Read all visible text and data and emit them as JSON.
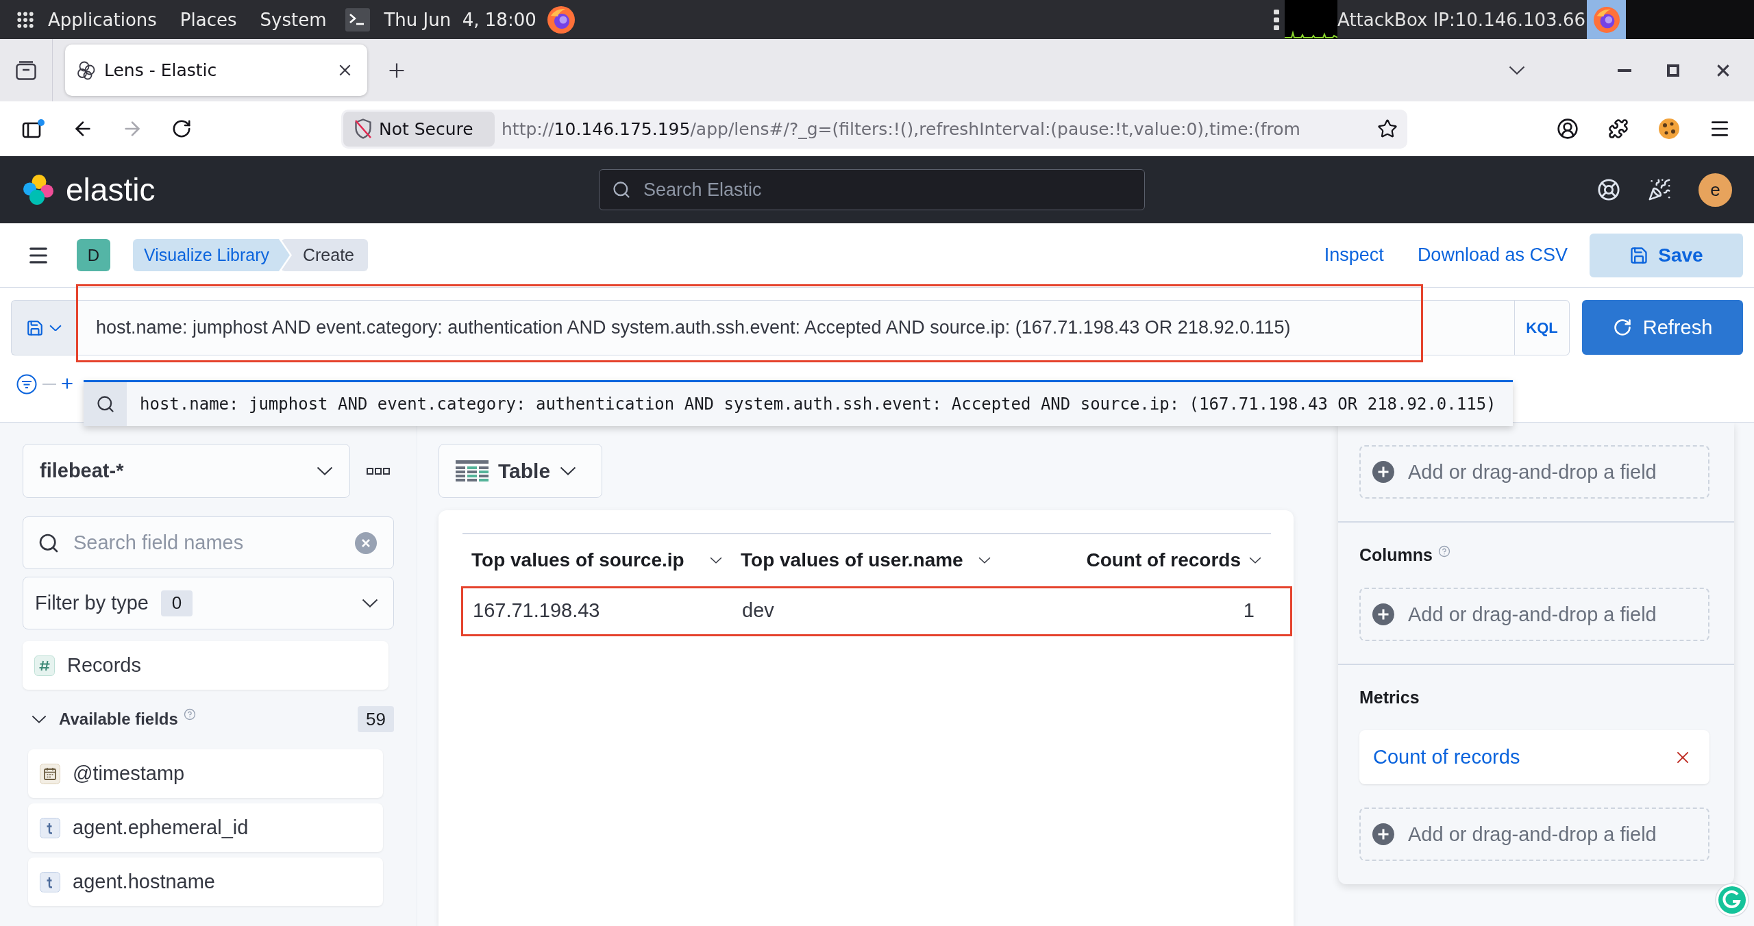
{
  "desktop_bar": {
    "menus": [
      "Applications",
      "Places",
      "System"
    ],
    "clock": "Thu Jun  4, 18:00",
    "status_text": "AttackBox IP:10.146.103.66"
  },
  "browser": {
    "tabs": [
      {
        "title": "Lens - Elastic",
        "selected": true
      }
    ],
    "security_label": "Not Secure",
    "url": {
      "scheme": "http://",
      "host": "10.146.175.195",
      "path": "/app/lens#/?_g=(filters:!(),refreshInterval:(pause:!t,value:0),time:(from"
    }
  },
  "kibana_header": {
    "brand": "elastic",
    "search": {
      "placeholder": "Search Elastic"
    },
    "avatar": "e"
  },
  "app_bar": {
    "space_badge": "D",
    "breadcrumbs": [
      {
        "label": "Visualize Library",
        "current": false
      },
      {
        "label": "Create",
        "current": true
      }
    ],
    "links": [
      "Inspect",
      "Download as CSV"
    ],
    "save_button": "Save"
  },
  "query_bar": {
    "query": "host.name: jumphost AND event.category: authentication AND system.auth.ssh.event: Accepted AND source.ip: (167.71.198.43 OR 218.92.0.115)",
    "highlighted": true,
    "language": "KQL",
    "refresh_button": "Refresh"
  },
  "suggestions": [
    "host.name: jumphost AND event.category: authentication AND system.auth.ssh.event: Accepted AND source.ip: (167.71.198.43 OR 218.92.0.115)"
  ],
  "sidebar": {
    "index_pattern": "filebeat-*",
    "field_search": {
      "placeholder": "Search field names"
    },
    "type_filter": {
      "label": "Filter by type",
      "count": "0"
    },
    "records": {
      "name": "Records",
      "kind": "number"
    },
    "available_fields": {
      "label": "Available fields",
      "help": true,
      "count": "59",
      "expanded": true,
      "fields": [
        {
          "name": "@timestamp",
          "kind": "date"
        },
        {
          "name": "agent.ephemeral_id",
          "kind": "string"
        },
        {
          "name": "agent.hostname",
          "kind": "string"
        }
      ]
    }
  },
  "workspace": {
    "chart_type": "Table",
    "table": {
      "columns": [
        {
          "label": "Top values of source.ip",
          "kind": "bucket"
        },
        {
          "label": "Top values of user.name",
          "kind": "bucket"
        },
        {
          "label": "Count of records",
          "kind": "metric"
        }
      ],
      "rows": [
        {
          "cells": [
            "167.71.198.43",
            "dev",
            "1"
          ],
          "highlighted": true
        }
      ]
    }
  },
  "config_panel": {
    "sections": [
      {
        "slots": [
          {
            "kind": "empty",
            "label": "Add or drag-and-drop a field"
          }
        ]
      },
      {
        "title": "Columns",
        "help": true,
        "slots": [
          {
            "kind": "empty",
            "label": "Add or drag-and-drop a field"
          }
        ]
      },
      {
        "title": "Metrics",
        "slots": [
          {
            "kind": "metric",
            "label": "Count of records"
          },
          {
            "kind": "empty",
            "label": "Add or drag-and-drop a field"
          }
        ]
      }
    ]
  }
}
